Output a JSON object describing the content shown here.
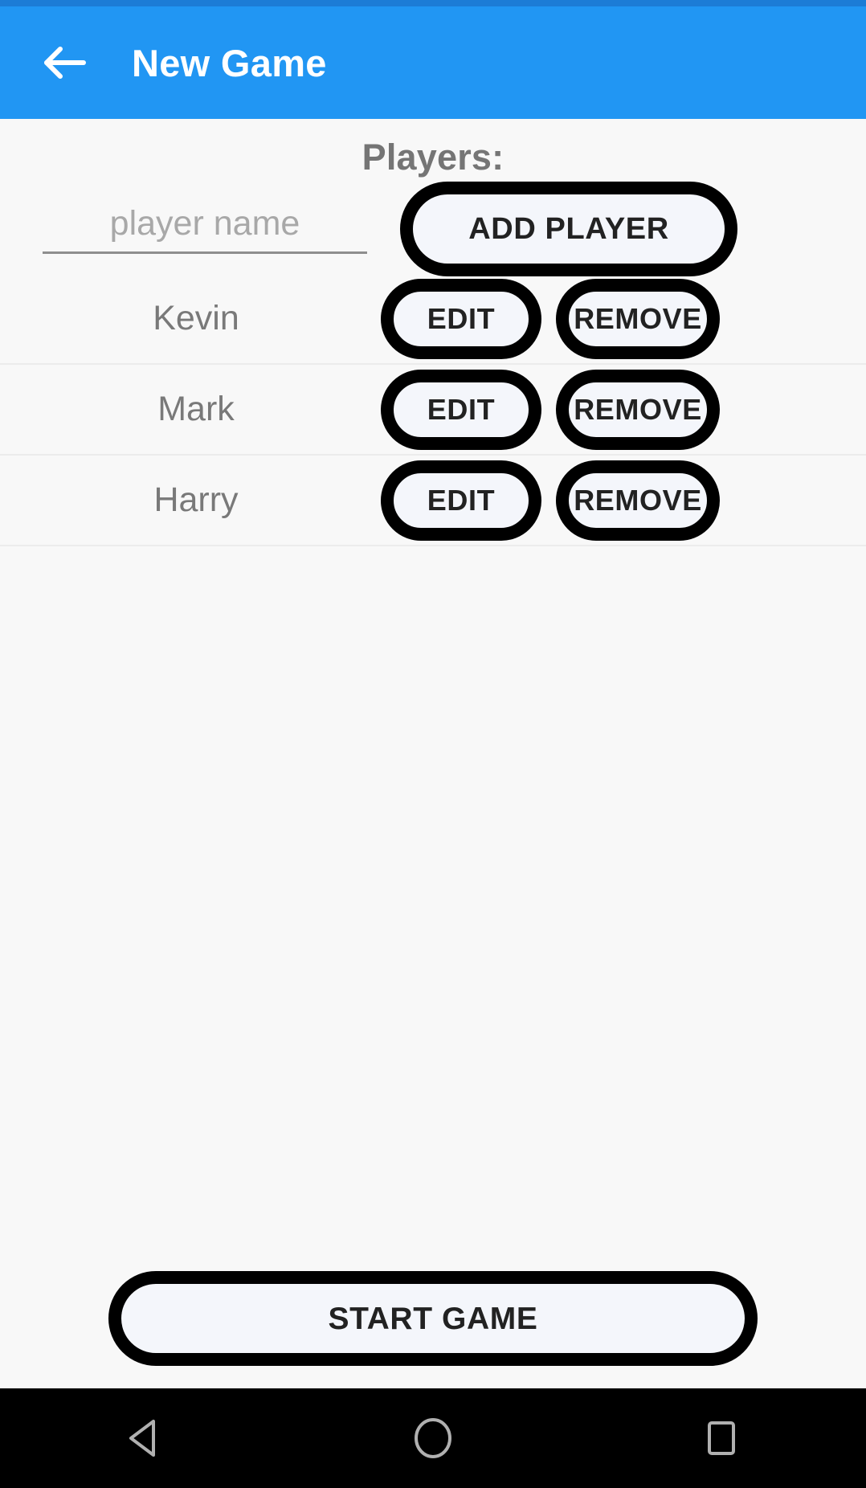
{
  "app_bar": {
    "title": "New Game",
    "back_icon": "arrow-left-icon",
    "background_color": "#2196f3",
    "title_color": "#ffffff"
  },
  "status_bar": {
    "background_color": "#1c7cd6"
  },
  "main": {
    "heading": "Players:",
    "heading_color": "#757575",
    "background_color": "#f8f8f8",
    "add_row": {
      "input_placeholder": "player name",
      "input_value": "",
      "add_button_label": "ADD PLAYER"
    },
    "players": [
      {
        "name": "Kevin",
        "edit_label": "EDIT",
        "remove_label": "REMOVE"
      },
      {
        "name": "Mark",
        "edit_label": "EDIT",
        "remove_label": "REMOVE"
      },
      {
        "name": "Harry",
        "edit_label": "EDIT",
        "remove_label": "REMOVE"
      }
    ],
    "start_button_label": "START GAME",
    "button_border_color": "#000000",
    "button_fill_color": "#f4f6fb"
  },
  "nav_bar": {
    "background_color": "#000000",
    "icon_color": "#b0b0b0",
    "buttons": [
      {
        "icon": "triangle-back-icon"
      },
      {
        "icon": "circle-home-icon"
      },
      {
        "icon": "square-recents-icon"
      }
    ]
  }
}
